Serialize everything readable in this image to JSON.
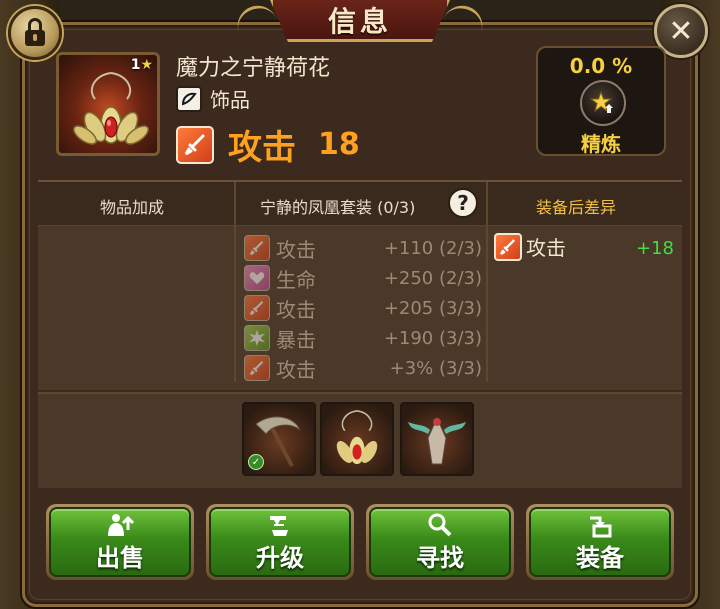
{
  "header": {
    "title": "信息"
  },
  "item": {
    "name": "魔力之宁静荷花",
    "stars": "1",
    "slot_label": "饰品",
    "main_stat_label": "攻击",
    "main_stat_value": "18"
  },
  "refine": {
    "percent": "0.0 %",
    "label": "精炼"
  },
  "table": {
    "col1_header": "物品加成",
    "col2_header": "宁静的凤凰套装 (0/3)",
    "col3_header": "装备后差异",
    "set_bonuses": [
      {
        "icon": "attack-icon",
        "name": "攻击",
        "value": "+110 (2/3)"
      },
      {
        "icon": "health-icon",
        "name": "生命",
        "value": "+250 (2/3)"
      },
      {
        "icon": "attack-icon",
        "name": "攻击",
        "value": "+205 (3/3)"
      },
      {
        "icon": "critical-icon",
        "name": "暴击",
        "value": "+190 (3/3)"
      },
      {
        "icon": "attack-icon",
        "name": "攻击",
        "value": "+3% (3/3)"
      }
    ],
    "diff": {
      "name": "攻击",
      "value": "+18"
    }
  },
  "set_pieces": [
    {
      "name": "weapon-piece",
      "equipped": true
    },
    {
      "name": "lotus-piece",
      "equipped": false
    },
    {
      "name": "phoenix-piece",
      "equipped": false
    }
  ],
  "buttons": {
    "sell": "出售",
    "upgrade": "升级",
    "find": "寻找",
    "equip": "装备"
  },
  "colors": {
    "gold": "#f5c040",
    "attack": "#ffa020",
    "positive": "#40e040",
    "button_green": "#3a8a1a"
  }
}
